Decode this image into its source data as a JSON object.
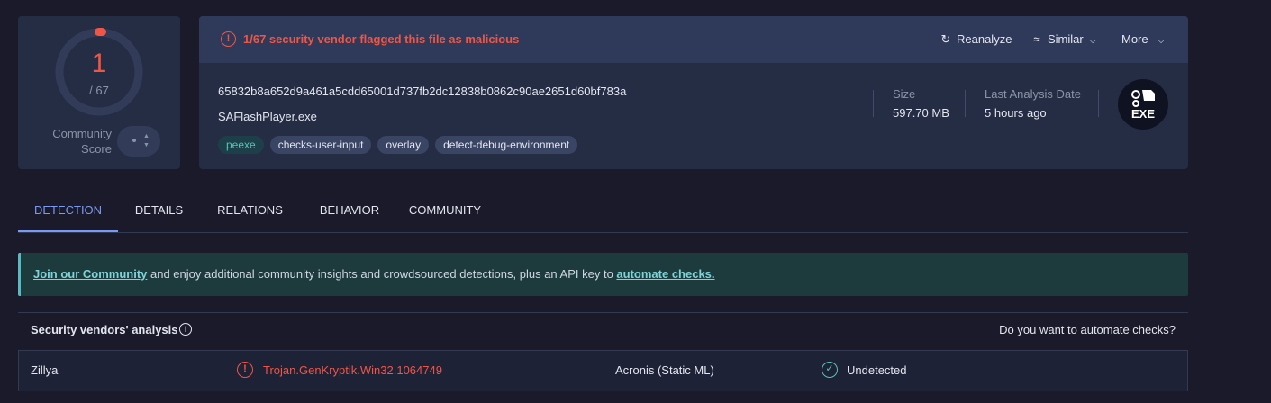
{
  "score": {
    "detections": "1",
    "total": "/ 67",
    "community_label": "Community Score",
    "malicious_fraction": 0.015
  },
  "alert": {
    "text": "1/67 security vendor flagged this file as malicious"
  },
  "header_actions": {
    "reanalyze": "Reanalyze",
    "similar": "Similar",
    "more": "More"
  },
  "file": {
    "hash": "65832b8a652d9a461a5cdd65001d737fb2dc12838b0862c90ae2651d60bf783a",
    "name": "SAFlashPlayer.exe",
    "tags": [
      "peexe",
      "checks-user-input",
      "overlay",
      "detect-debug-environment"
    ],
    "size_label": "Size",
    "size_value": "597.70 MB",
    "last_analysis_label": "Last Analysis Date",
    "last_analysis_value": "5 hours ago",
    "type_badge": "EXE"
  },
  "tabs": [
    "DETECTION",
    "DETAILS",
    "RELATIONS",
    "BEHAVIOR",
    "COMMUNITY"
  ],
  "banner": {
    "link1": "Join our Community",
    "middle": " and enjoy additional community insights and crowdsourced detections, plus an API key to ",
    "link2": "automate checks."
  },
  "vendors": {
    "title": "Security vendors' analysis",
    "automate_prompt": "Do you want to automate checks?",
    "rows": [
      {
        "vendor1": "Zillya",
        "result1": "Trojan.GenKryptik.Win32.1064749",
        "vendor2": "Acronis (Static ML)",
        "result2": "Undetected"
      }
    ]
  },
  "colors": {
    "malicious": "#f05545",
    "accent": "#7b9bf2",
    "clean": "#53c5b4"
  }
}
